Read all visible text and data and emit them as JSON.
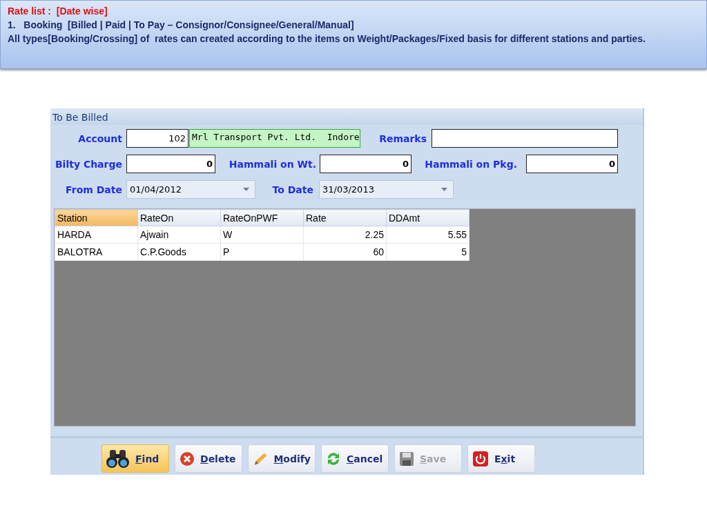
{
  "slide": {
    "title": "Rate list :  [Date wise]",
    "lines": [
      "1.   Booking  [Billed | Paid | To Pay – Consignor/Consignee/General/Manual]",
      "All types[Booking/Crossing] of  rates can created according to the items on Weight/Packages/Fixed basis for different stations and parties."
    ]
  },
  "window": {
    "title": "To Be Billed",
    "account": {
      "label": "Account",
      "code": "102",
      "name": "Mrl Transport Pvt. Ltd.  Indore"
    },
    "remarks": {
      "label": "Remarks"
    },
    "charges": [
      {
        "label": "Bilty Charge",
        "value": "0"
      },
      {
        "label": "Hammali on Wt.",
        "value": "0"
      },
      {
        "label": "Hammali on Pkg.",
        "value": "0"
      }
    ],
    "dates": [
      {
        "label": "From Date",
        "value": "01/04/2012"
      },
      {
        "label": "To Date",
        "value": "31/03/2013"
      }
    ],
    "table": {
      "columns": [
        {
          "label": "Station",
          "selected": true,
          "kind": "text"
        },
        {
          "label": "RateOn",
          "selected": false,
          "kind": "text"
        },
        {
          "label": "RateOnPWF",
          "selected": false,
          "kind": "text"
        },
        {
          "label": "Rate",
          "selected": false,
          "kind": "number"
        },
        {
          "label": "DDAmt",
          "selected": false,
          "kind": "number"
        }
      ],
      "rows": [
        [
          "HARDA",
          "Ajwain",
          "W",
          "2.25",
          "5.55"
        ],
        [
          "BALOTRA",
          "C.P.Goods",
          "P",
          "60",
          "5"
        ]
      ]
    },
    "buttons": [
      {
        "kind": "find",
        "key": "F",
        "post": "ind",
        "highlighted": true,
        "disabled": false
      },
      {
        "kind": "delete",
        "key": "D",
        "post": "elete",
        "highlighted": false,
        "disabled": false
      },
      {
        "kind": "modify",
        "key": "M",
        "post": "odify",
        "highlighted": false,
        "disabled": false
      },
      {
        "kind": "cancel",
        "key": "C",
        "post": "ancel",
        "highlighted": false,
        "disabled": false
      },
      {
        "kind": "save",
        "key": "S",
        "post": "ave",
        "highlighted": false,
        "disabled": true
      },
      {
        "kind": "exit",
        "pre": "E",
        "key": "x",
        "post": "it",
        "highlighted": false,
        "disabled": false
      }
    ]
  }
}
